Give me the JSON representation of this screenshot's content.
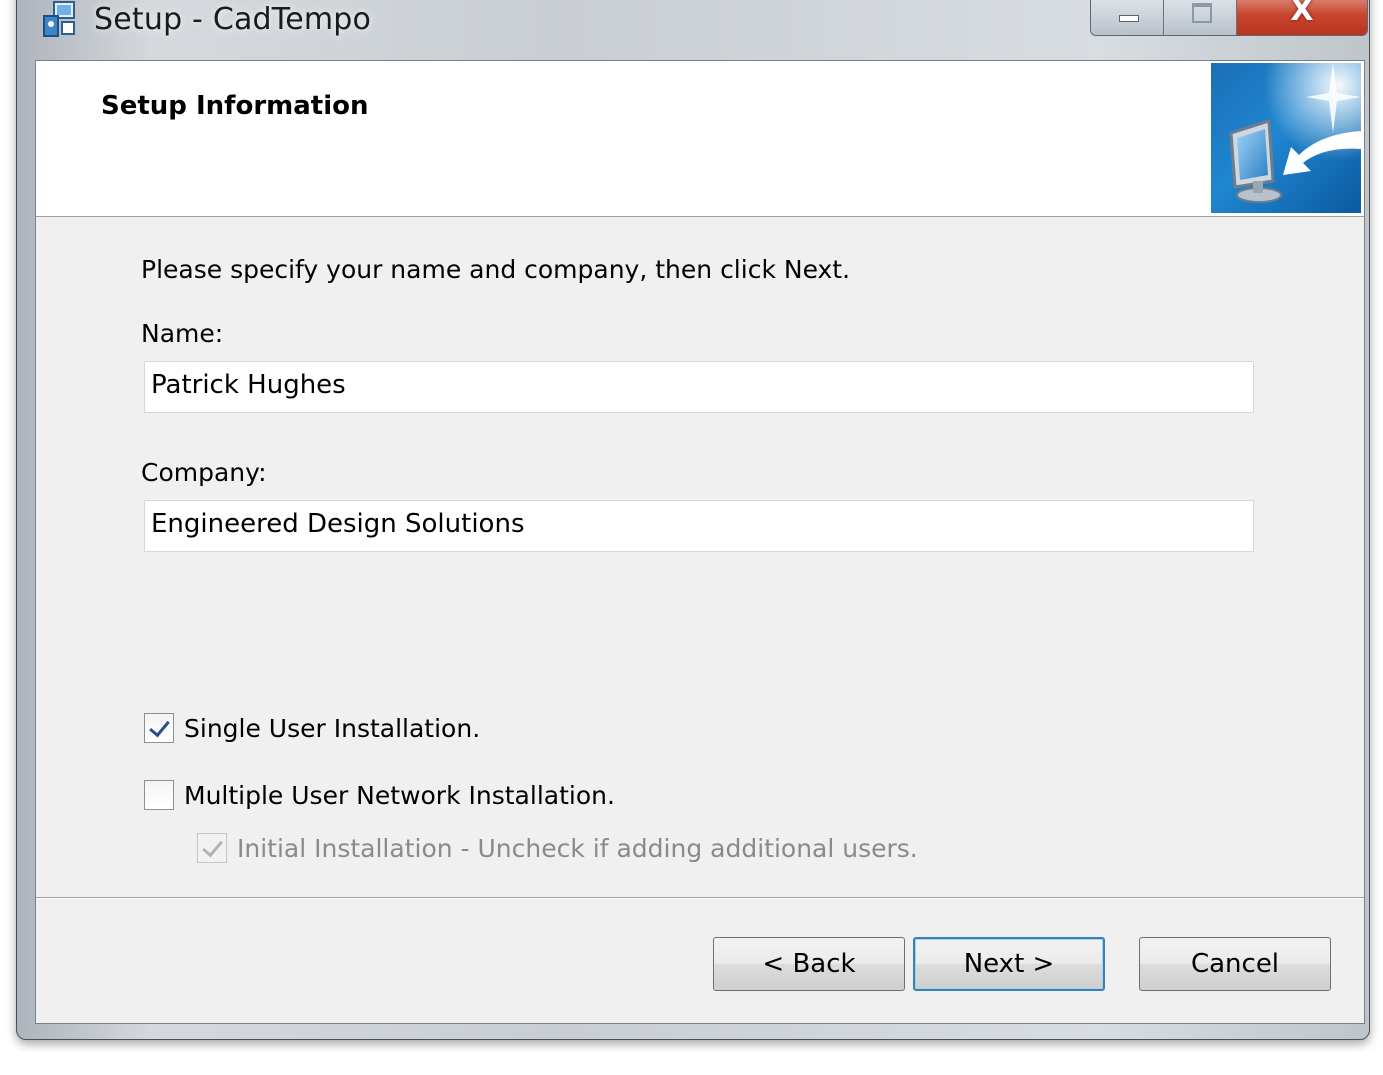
{
  "window": {
    "title": "Setup - CadTempo",
    "controls": {
      "minimize_icon": "minimize-icon",
      "maximize_icon": "maximize-icon",
      "close_glyph": "X"
    }
  },
  "header": {
    "title": "Setup Information",
    "image_icon": "monitor-with-arrow-icon"
  },
  "main": {
    "instruction": "Please specify your name and company, then click Next.",
    "name": {
      "label": "Name:",
      "value": "Patrick Hughes"
    },
    "company": {
      "label": "Company:",
      "value": "Engineered Design Solutions"
    },
    "options": [
      {
        "label": "Single User Installation.",
        "checked": true,
        "enabled": true
      },
      {
        "label": "Multiple User Network Installation.",
        "checked": false,
        "enabled": true
      },
      {
        "label": "Initial Installation - Uncheck if adding additional users.",
        "checked": true,
        "enabled": false
      }
    ]
  },
  "buttons": {
    "back": "< Back",
    "next": "Next >",
    "cancel": "Cancel"
  },
  "colors": {
    "client_bg": "#f0f0f0",
    "header_bg": "#ffffff",
    "close_button": "#c8462f",
    "default_button_border": "#3c7fb1"
  }
}
